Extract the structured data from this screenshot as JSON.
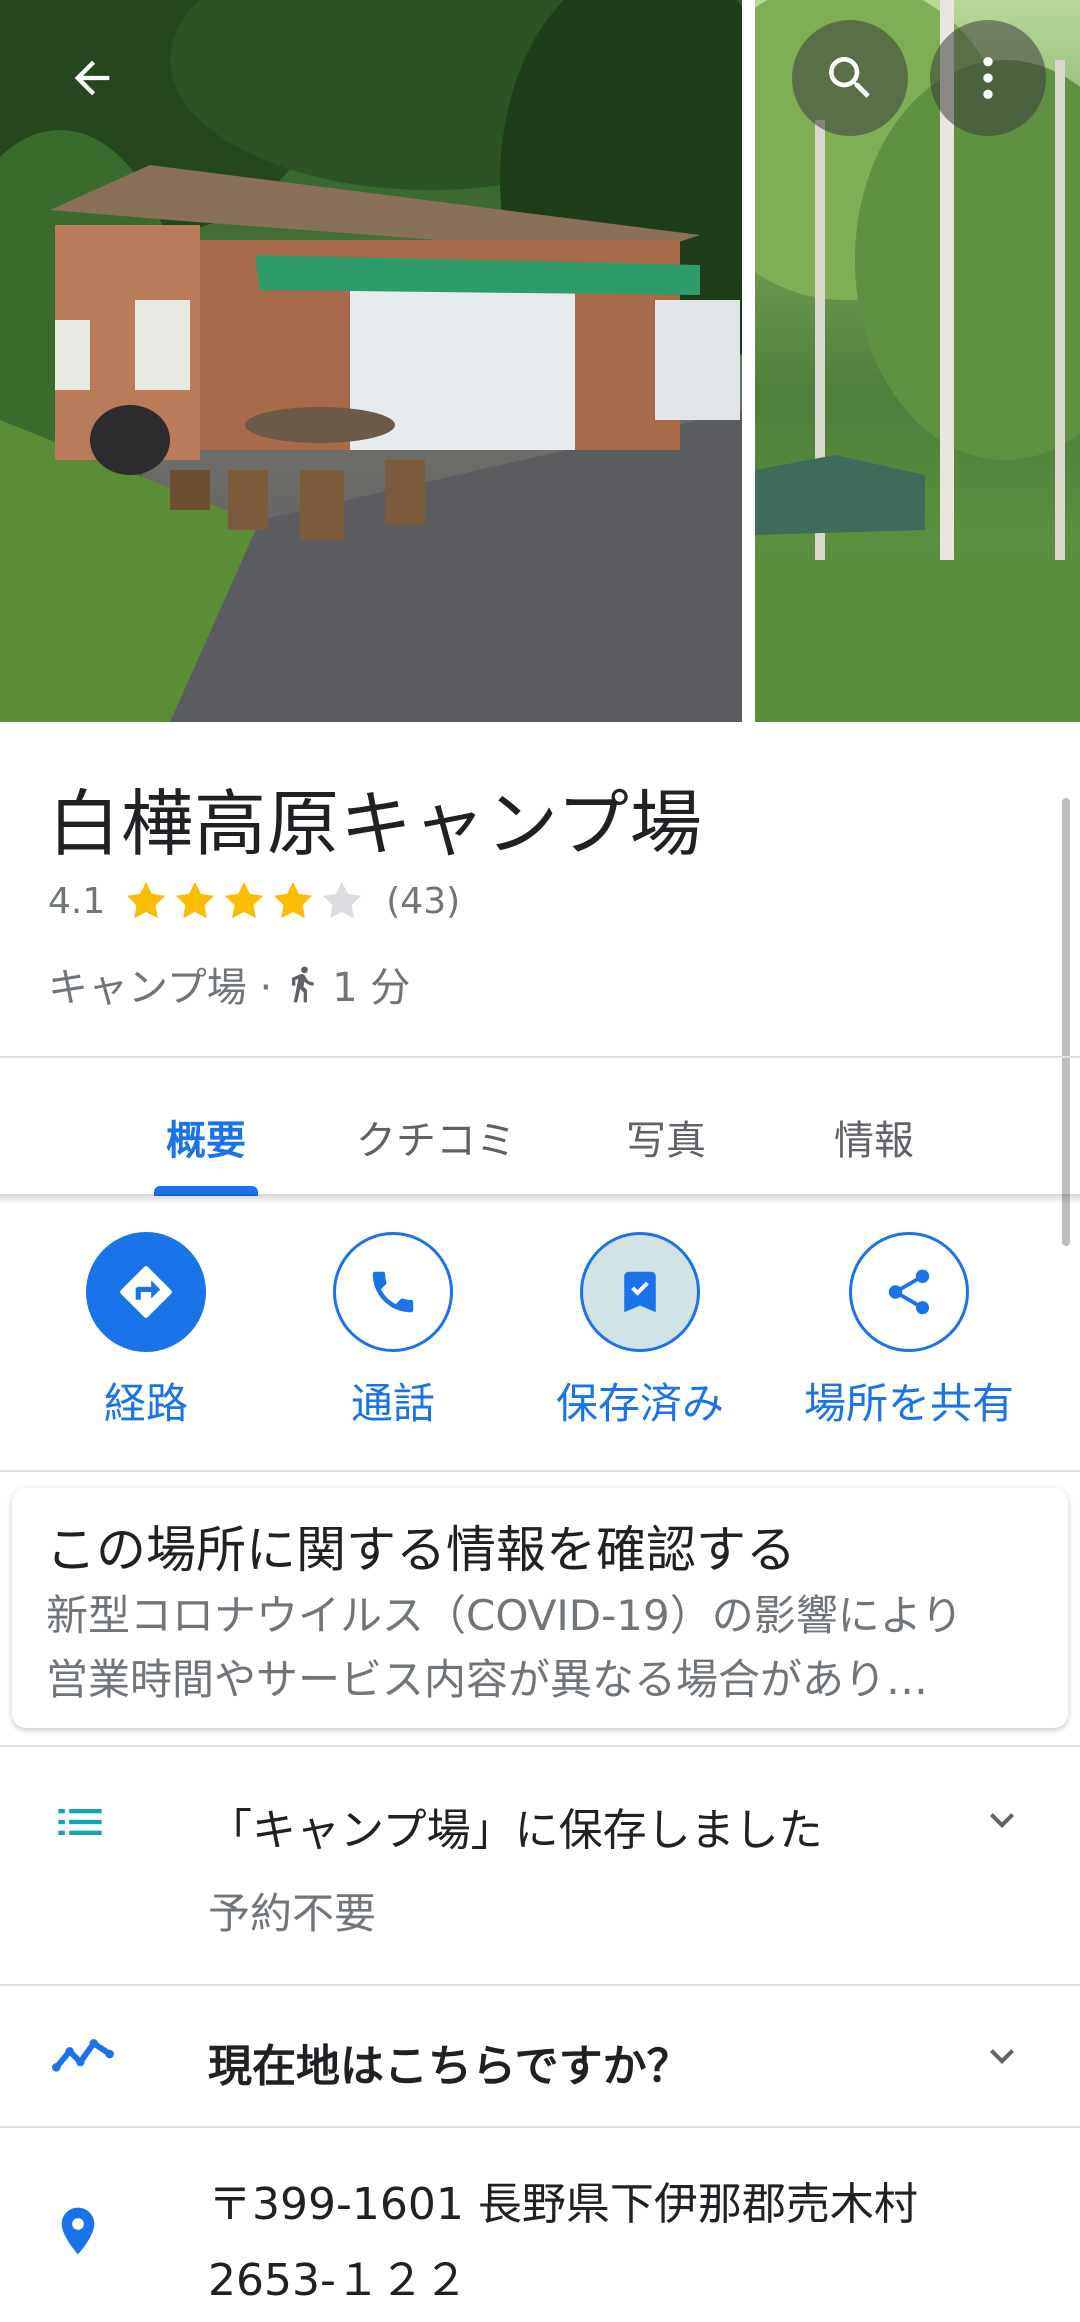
{
  "header": {
    "back_icon": "arrow-back-icon",
    "search_icon": "search-icon",
    "more_icon": "more-vert-icon"
  },
  "place": {
    "name": "白樺高原キャンプ場",
    "rating": "4.1",
    "stars": 4.1,
    "review_count": "(43)",
    "category": "キャンプ場 ·",
    "walk_time": "1 分"
  },
  "tabs": [
    {
      "label": "概要",
      "active": true
    },
    {
      "label": "クチコミ",
      "active": false
    },
    {
      "label": "写真",
      "active": false
    },
    {
      "label": "情報",
      "active": false
    }
  ],
  "actions": [
    {
      "label": "経路",
      "icon": "directions-icon"
    },
    {
      "label": "通話",
      "icon": "phone-icon"
    },
    {
      "label": "保存済み",
      "icon": "bookmark-check-icon"
    },
    {
      "label": "場所を共有",
      "icon": "share-icon"
    }
  ],
  "info_card": {
    "title": "この場所に関する情報を確認する",
    "line1": "新型コロナウイルス（COVID-19）の影響により",
    "line2": "営業時間やサービス内容が異なる場合があり…"
  },
  "saved_row": {
    "title": "「キャンプ場」に保存しました",
    "note": "予約不要"
  },
  "location_row": {
    "title": "現在地はこちらですか？"
  },
  "address_row": {
    "line1": "〒399-1601 長野県下伊那郡売木村",
    "line2": "2653-１２２"
  },
  "colors": {
    "accent": "#1a73e8",
    "star": "#fbbc04",
    "text_primary": "#202124",
    "text_secondary": "#70757a"
  }
}
